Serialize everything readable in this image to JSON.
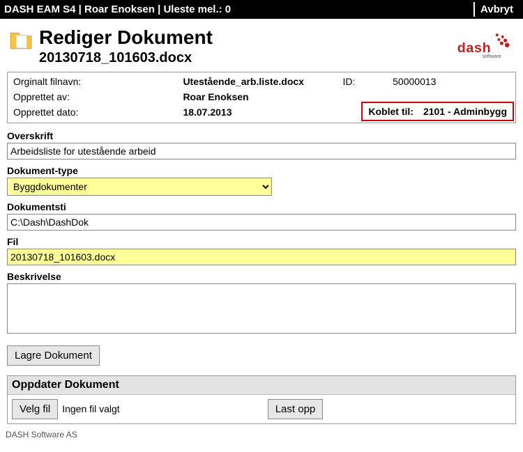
{
  "topbar": {
    "title": "DASH EAM S4 | Roar Enoksen | Uleste mel.: 0",
    "cancel": "Avbryt"
  },
  "title": {
    "heading": "Rediger Dokument",
    "filename": "20130718_101603.docx"
  },
  "logo": {
    "brand": "dash",
    "sub": "software"
  },
  "details": {
    "orig_label": "Orginalt filnavn:",
    "orig_value": "Utestående_arb.liste.docx",
    "id_label": "ID:",
    "id_value": "50000013",
    "created_by_label": "Opprettet av:",
    "created_by_value": "Roar Enoksen",
    "created_date_label": "Opprettet dato:",
    "created_date_value": "18.07.2013",
    "koblet_label": "Koblet til:",
    "koblet_value": "2101 - Adminbygg"
  },
  "form": {
    "overskrift_label": "Overskrift",
    "overskrift_value": "Arbeidsliste for utestående arbeid",
    "doktype_label": "Dokument-type",
    "doktype_value": "Byggdokumenter",
    "doksti_label": "Dokumentsti",
    "doksti_value": "C:\\Dash\\DashDok",
    "fil_label": "Fil",
    "fil_value": "20130718_101603.docx",
    "beskrivelse_label": "Beskrivelse",
    "beskrivelse_value": "",
    "save_button": "Lagre Dokument"
  },
  "update": {
    "heading": "Oppdater Dokument",
    "choose": "Velg fil",
    "none": "Ingen fil valgt",
    "upload": "Last opp"
  },
  "footer": "DASH Software AS"
}
